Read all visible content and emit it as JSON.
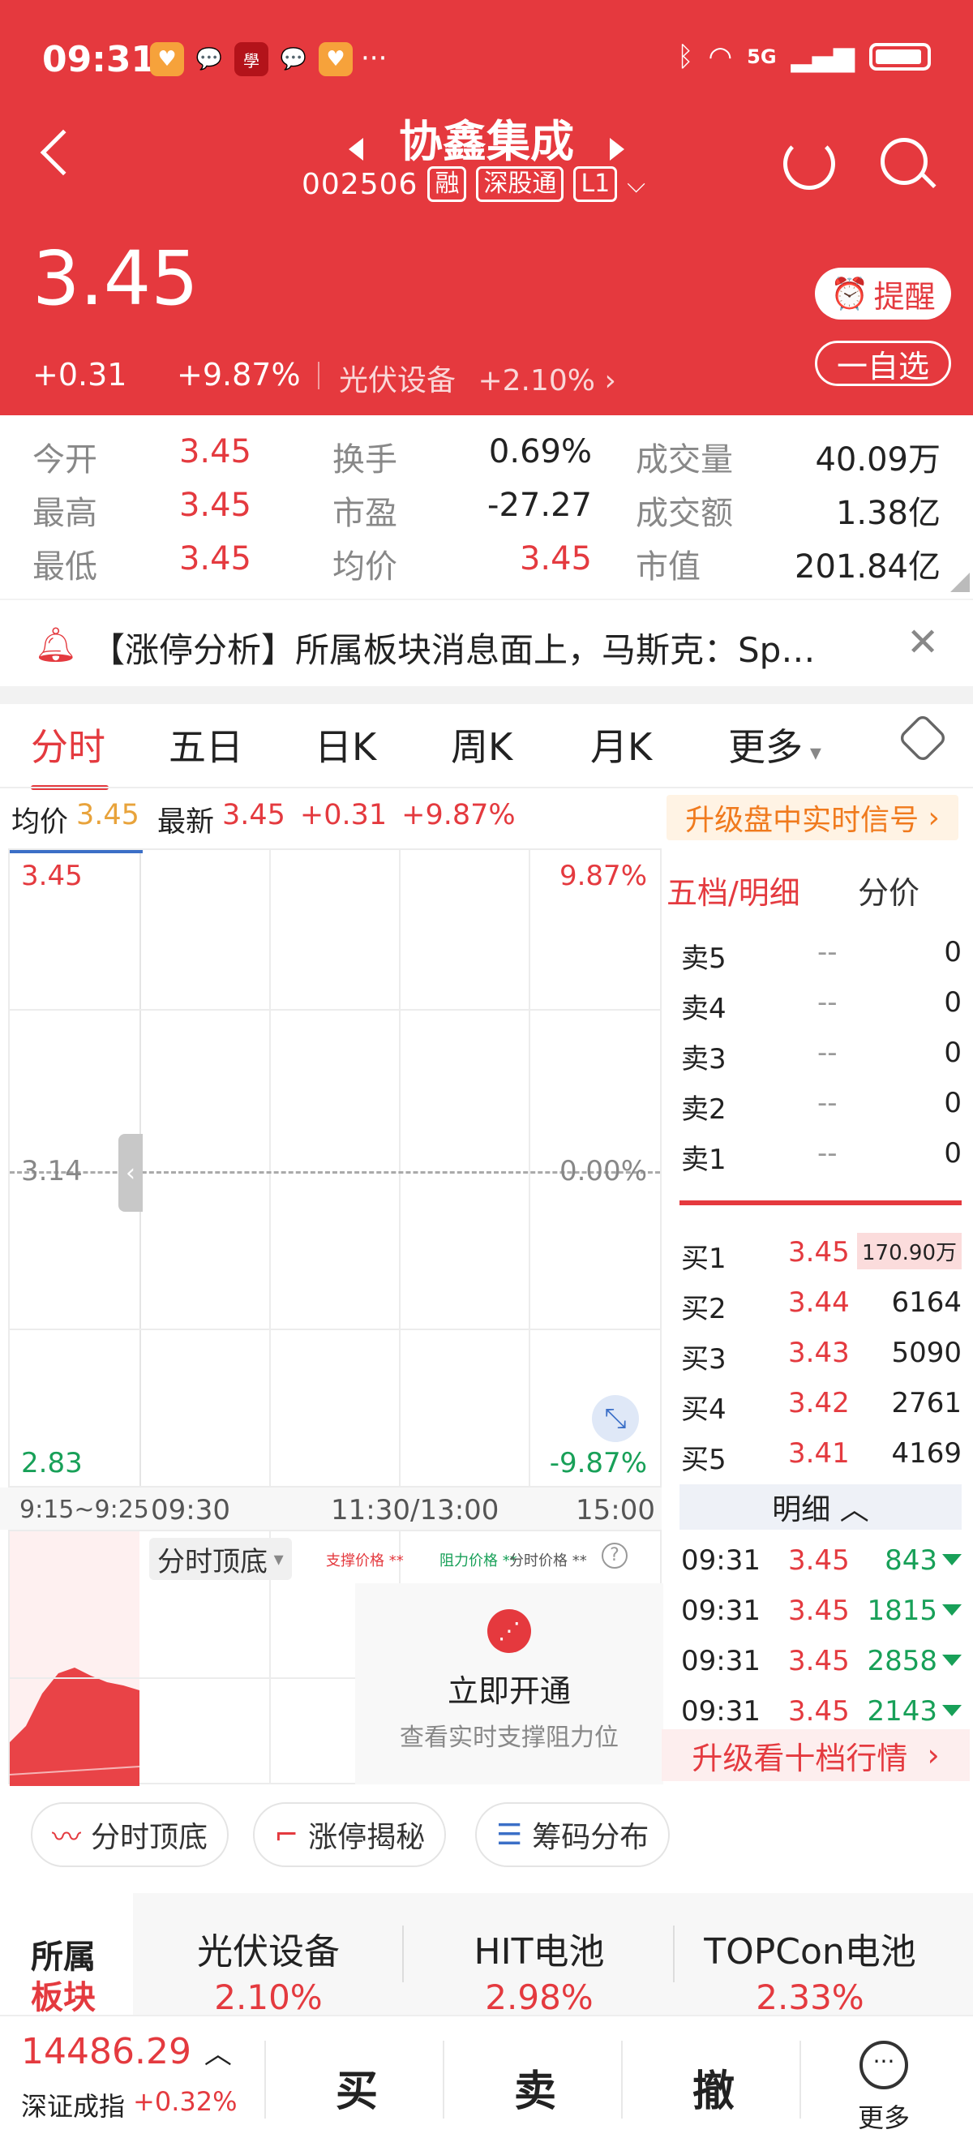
{
  "status_bar": {
    "time": "09:31",
    "network": "5G"
  },
  "header": {
    "title": "协鑫集成",
    "code": "002506",
    "tags": [
      "融",
      "深股通",
      "L1"
    ],
    "price": "3.45",
    "change": "+0.31",
    "change_pct": "+9.87%",
    "sector_name": "光伏设备",
    "sector_pct": "+2.10%",
    "remind_label": "提醒",
    "watchlist_label": "一自选"
  },
  "quote": {
    "rows": [
      [
        {
          "label": "今开",
          "value": "3.45",
          "color": "red"
        },
        {
          "label": "换手",
          "value": "0.69%",
          "color": "black"
        },
        {
          "label": "成交量",
          "value": "40.09万",
          "color": "black"
        }
      ],
      [
        {
          "label": "最高",
          "value": "3.45",
          "color": "red"
        },
        {
          "label": "市盈",
          "value": "-27.27",
          "color": "black"
        },
        {
          "label": "成交额",
          "value": "1.38亿",
          "color": "black"
        }
      ],
      [
        {
          "label": "最低",
          "value": "3.45",
          "color": "red"
        },
        {
          "label": "均价",
          "value": "3.45",
          "color": "red"
        },
        {
          "label": "市值",
          "value": "201.84亿",
          "color": "black"
        }
      ]
    ]
  },
  "news": {
    "text": "【涨停分析】所属板块消息面上，马斯克：Sp…"
  },
  "tabs": [
    "分时",
    "五日",
    "日K",
    "周K",
    "月K",
    "更多"
  ],
  "chart_info": {
    "avg_label": "均价",
    "avg_value": "3.45",
    "latest_label": "最新",
    "latest_value": "3.45",
    "latest_change": "+0.31",
    "latest_pct": "+9.87%",
    "upgrade_signal": "升级盘中实时信号"
  },
  "chart_data": {
    "type": "line",
    "y_left_ticks": [
      "3.45",
      "3.14",
      "2.83"
    ],
    "y_right_ticks": [
      "9.87%",
      "0.00%",
      "-9.87%"
    ],
    "x_ticks": [
      "9:15~9:25",
      "09:30",
      "11:30/13:00",
      "15:00"
    ],
    "ylim": [
      2.83,
      3.45
    ],
    "series": [
      {
        "x": [
          "09:30",
          "09:31"
        ],
        "values": [
          3.45,
          3.45
        ]
      }
    ]
  },
  "indicator": {
    "name": "分时顶底",
    "legend": [
      "支撑价格 **",
      "阻力价格 **",
      "分时价格 **"
    ],
    "open_title": "立即开通",
    "open_sub": "查看实时支撑阻力位"
  },
  "orderbook": {
    "tab_active": "五档/明细",
    "tab_other": "分价",
    "sells": [
      {
        "label": "卖5",
        "price": "--",
        "vol": "0"
      },
      {
        "label": "卖4",
        "price": "--",
        "vol": "0"
      },
      {
        "label": "卖3",
        "price": "--",
        "vol": "0"
      },
      {
        "label": "卖2",
        "price": "--",
        "vol": "0"
      },
      {
        "label": "卖1",
        "price": "--",
        "vol": "0"
      }
    ],
    "buys": [
      {
        "label": "买1",
        "price": "3.45",
        "vol": "170.90万"
      },
      {
        "label": "买2",
        "price": "3.44",
        "vol": "6164"
      },
      {
        "label": "买3",
        "price": "3.43",
        "vol": "5090"
      },
      {
        "label": "买4",
        "price": "3.42",
        "vol": "2761"
      },
      {
        "label": "买5",
        "price": "3.41",
        "vol": "4169"
      }
    ],
    "detail_header": "明细",
    "details": [
      {
        "time": "09:31",
        "price": "3.45",
        "vol": "843"
      },
      {
        "time": "09:31",
        "price": "3.45",
        "vol": "1815"
      },
      {
        "time": "09:31",
        "price": "3.45",
        "vol": "2858"
      },
      {
        "time": "09:31",
        "price": "3.45",
        "vol": "2143"
      }
    ],
    "upgrade_ten": "升级看十档行情"
  },
  "features": [
    "分时顶底",
    "涨停揭秘",
    "筹码分布"
  ],
  "sectors": {
    "label_top": "所属",
    "label_bottom": "板块",
    "items": [
      {
        "name": "光伏设备",
        "pct": "2.10%"
      },
      {
        "name": "HIT电池",
        "pct": "2.98%"
      },
      {
        "name": "TOPCon电池",
        "pct": "2.33%"
      }
    ]
  },
  "bottom": {
    "index_value": "14486.29",
    "index_name": "深证成指",
    "index_pct": "+0.32%",
    "buy": "买",
    "sell": "卖",
    "cancel": "撤",
    "more": "更多"
  }
}
